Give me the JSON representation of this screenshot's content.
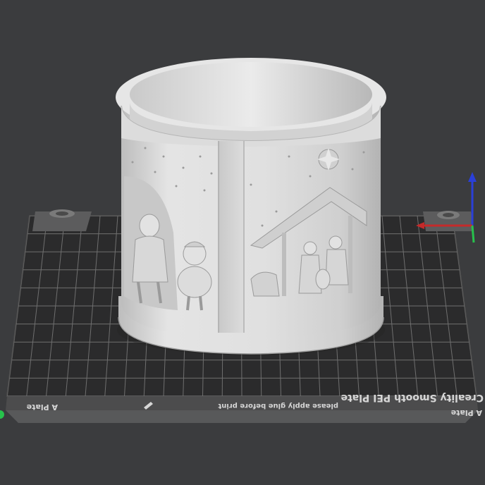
{
  "scene": {
    "background_color": "#3b3c3e",
    "bed_color": "#2b2b2c",
    "grid_color": "#6f6f6f",
    "model_color": "#d9d9d9"
  },
  "build_plate": {
    "brand_label": "Creality Smooth PEI Plate",
    "notice_label": "please apply glue before print",
    "side_label_left": "A Plate",
    "side_label_right": "A Plate"
  },
  "axis_gizmo": {
    "x_color": "#c42a2a",
    "y_color": "#27c24c",
    "z_color": "#2a3fd8"
  },
  "status_indicator_color": "#27c24c"
}
